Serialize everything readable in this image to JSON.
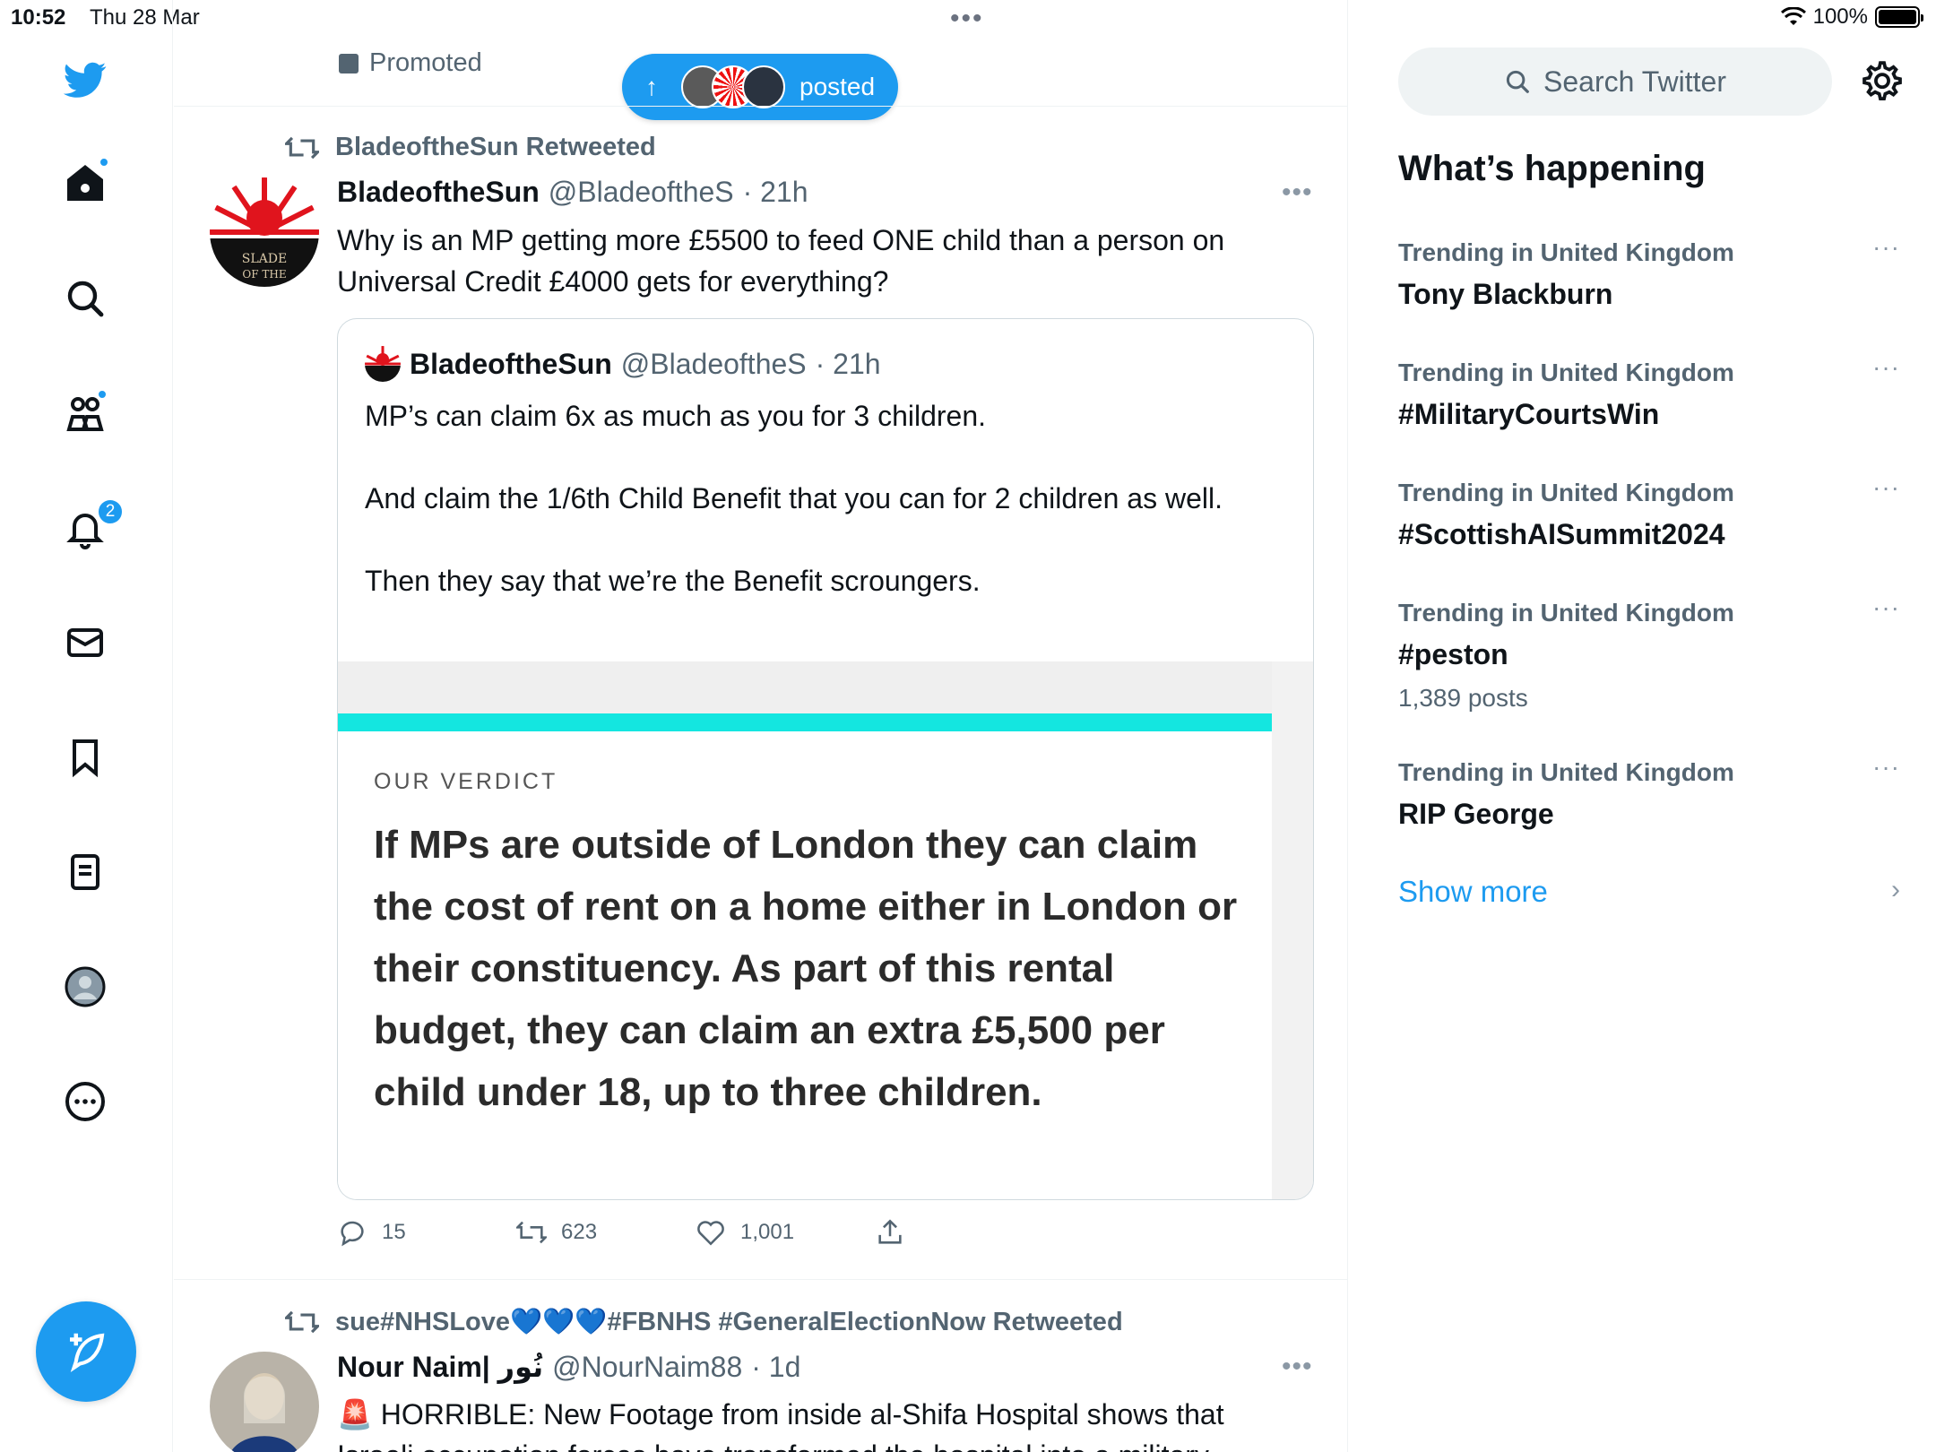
{
  "status_bar": {
    "time": "10:52",
    "date": "Thu 28 Mar",
    "battery": "100%",
    "battery_level": 1.0
  },
  "nav": {
    "items": [
      "twitter-logo",
      "home-icon",
      "search-icon",
      "communities-icon",
      "notifications-icon",
      "messages-icon",
      "bookmarks-icon",
      "lists-icon",
      "profile-icon",
      "more-icon"
    ],
    "notification_count": "2",
    "compose": "compose-icon"
  },
  "feed": {
    "promoted_label": "Promoted",
    "posted_pill_label": "posted",
    "tweet1": {
      "retweeted_by": "BladeoftheSun Retweeted",
      "name": "BladeoftheSun",
      "handle": "@BladeoftheS",
      "time": "· 21h",
      "text": "Why is an MP getting more £5500 to feed ONE child than a person on Universal Credit £4000 gets for everything?",
      "quote": {
        "name": "BladeoftheSun",
        "handle": "@BladeoftheS",
        "time": "· 21h",
        "text": "MP’s can claim 6x as much as you for 3 children.\n\nAnd claim the 1/6th Child Benefit that you can for 2 children as well.\n\nThen they say that we’re the Benefit scroungers.",
        "image": {
          "label": "OUR VERDICT",
          "text": "If MPs are outside of London they can claim the cost of rent on a home either in London or their constituency. As part of this rental budget, they can claim an extra £5,500 per child under 18, up to three children."
        }
      },
      "replies": "15",
      "retweets": "623",
      "likes": "1,001"
    },
    "tweet2": {
      "retweeted_by": "sue#NHSLove💙💙💙#FBNHS #GeneralElectionNow Retweeted",
      "name": "Nour Naim| نُور",
      "handle": "@NourNaim88",
      "time": "· 1d",
      "text": "🚨 HORRIBLE: New Footage from inside al-Shifa Hospital shows that Israeli occupation forces have transformed the hospital into a military"
    }
  },
  "sidebar": {
    "search_placeholder": "Search Twitter",
    "heading": "What’s happening",
    "trends": [
      {
        "meta": "Trending in United Kingdom",
        "name": "Tony Blackburn",
        "count": ""
      },
      {
        "meta": "Trending in United Kingdom",
        "name": "#MilitaryCourtsWin",
        "count": ""
      },
      {
        "meta": "Trending in United Kingdom",
        "name": "#ScottishAISummit2024",
        "count": ""
      },
      {
        "meta": "Trending in United Kingdom",
        "name": "#peston",
        "count": "1,389 posts"
      },
      {
        "meta": "Trending in United Kingdom",
        "name": "RIP George",
        "count": ""
      }
    ],
    "show_more": "Show more",
    "more_glyph": "···",
    "chevron": "›"
  },
  "colors": {
    "accent": "#1d9bf0",
    "secondary_text": "#536471",
    "teal_bar": "#14e6e0"
  }
}
